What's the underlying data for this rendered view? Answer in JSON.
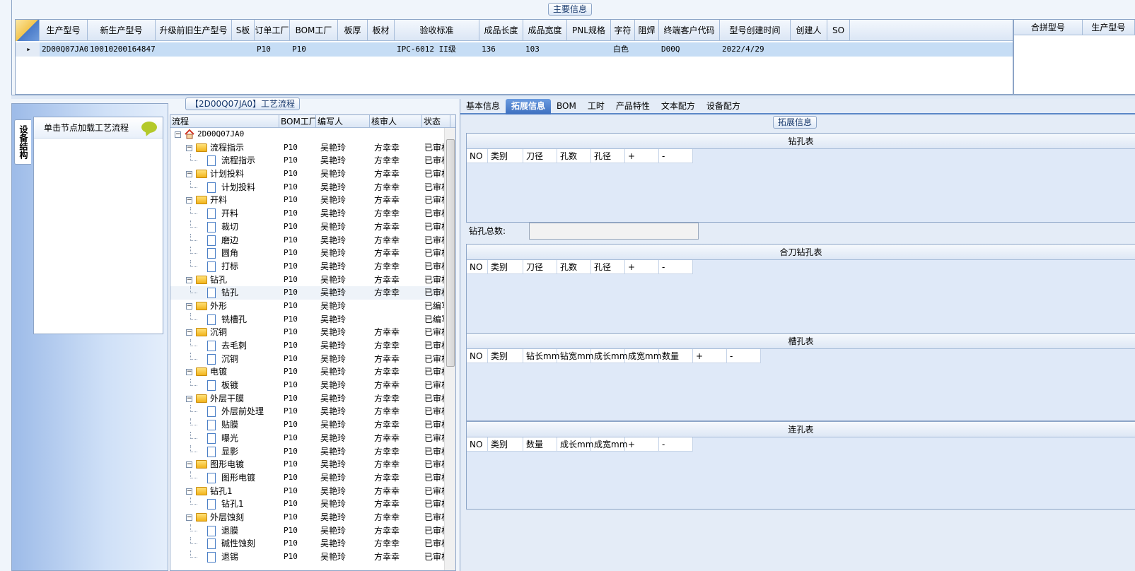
{
  "main_info": {
    "caption": "主要信息",
    "columns": [
      "生产型号",
      "新生产型号",
      "升级前旧生产型号",
      "S板",
      "订单工厂",
      "BOM工厂",
      "板厚",
      "板材",
      "验收标准",
      "成品长度",
      "成品宽度",
      "PNL规格",
      "字符",
      "阻焊",
      "终端客户代码",
      "型号创建时间",
      "创建人",
      "SO"
    ],
    "row": [
      "2D00Q07JA0",
      "10010200164847",
      "",
      "",
      "P10",
      "P10",
      "",
      "",
      "IPC-6012 II级",
      "136",
      "103",
      "",
      "白色",
      "",
      "D00Q",
      "2022/4/29",
      "",
      ""
    ]
  },
  "side_grid": {
    "columns": [
      "合拼型号",
      "生产型号"
    ]
  },
  "left_panel": {
    "vtab_label": "设备结构",
    "node_hint": "单击节点加载工艺流程"
  },
  "process": {
    "caption": "【2D00Q07JA0】工艺流程",
    "columns": [
      "流程",
      "BOM工厂",
      "编写人",
      "核审人",
      "状态"
    ],
    "rows": [
      {
        "level": 0,
        "type": "root",
        "name": "2D00Q07JA0",
        "bom": "",
        "writer": "",
        "checker": "",
        "status": ""
      },
      {
        "level": 1,
        "type": "folder",
        "name": "流程指示",
        "bom": "P10",
        "writer": "吴艳玲",
        "checker": "方幸幸",
        "status": "已审核"
      },
      {
        "level": 2,
        "type": "doc",
        "name": "流程指示",
        "bom": "P10",
        "writer": "吴艳玲",
        "checker": "方幸幸",
        "status": "已审核"
      },
      {
        "level": 1,
        "type": "folder",
        "name": "计划投料",
        "bom": "P10",
        "writer": "吴艳玲",
        "checker": "方幸幸",
        "status": "已审核"
      },
      {
        "level": 2,
        "type": "doc",
        "name": "计划投料",
        "bom": "P10",
        "writer": "吴艳玲",
        "checker": "方幸幸",
        "status": "已审核"
      },
      {
        "level": 1,
        "type": "folder",
        "name": "开料",
        "bom": "P10",
        "writer": "吴艳玲",
        "checker": "方幸幸",
        "status": "已审核"
      },
      {
        "level": 2,
        "type": "doc",
        "name": "开料",
        "bom": "P10",
        "writer": "吴艳玲",
        "checker": "方幸幸",
        "status": "已审核"
      },
      {
        "level": 2,
        "type": "doc",
        "name": "裁切",
        "bom": "P10",
        "writer": "吴艳玲",
        "checker": "方幸幸",
        "status": "已审核"
      },
      {
        "level": 2,
        "type": "doc",
        "name": "磨边",
        "bom": "P10",
        "writer": "吴艳玲",
        "checker": "方幸幸",
        "status": "已审核"
      },
      {
        "level": 2,
        "type": "doc",
        "name": "圆角",
        "bom": "P10",
        "writer": "吴艳玲",
        "checker": "方幸幸",
        "status": "已审核"
      },
      {
        "level": 2,
        "type": "doc",
        "name": "打标",
        "bom": "P10",
        "writer": "吴艳玲",
        "checker": "方幸幸",
        "status": "已审核"
      },
      {
        "level": 1,
        "type": "folder",
        "name": "钻孔",
        "bom": "P10",
        "writer": "吴艳玲",
        "checker": "方幸幸",
        "status": "已审核"
      },
      {
        "level": 2,
        "type": "doc",
        "name": "钻孔",
        "bom": "P10",
        "writer": "吴艳玲",
        "checker": "方幸幸",
        "status": "已审核",
        "selected": true
      },
      {
        "level": 1,
        "type": "folder",
        "name": "外形",
        "bom": "P10",
        "writer": "吴艳玲",
        "checker": "",
        "status": "已编写"
      },
      {
        "level": 2,
        "type": "doc",
        "name": "铣槽孔",
        "bom": "P10",
        "writer": "吴艳玲",
        "checker": "",
        "status": "已编写"
      },
      {
        "level": 1,
        "type": "folder",
        "name": "沉铜",
        "bom": "P10",
        "writer": "吴艳玲",
        "checker": "方幸幸",
        "status": "已审核"
      },
      {
        "level": 2,
        "type": "doc",
        "name": "去毛刺",
        "bom": "P10",
        "writer": "吴艳玲",
        "checker": "方幸幸",
        "status": "已审核"
      },
      {
        "level": 2,
        "type": "doc",
        "name": "沉铜",
        "bom": "P10",
        "writer": "吴艳玲",
        "checker": "方幸幸",
        "status": "已审核"
      },
      {
        "level": 1,
        "type": "folder",
        "name": "电镀",
        "bom": "P10",
        "writer": "吴艳玲",
        "checker": "方幸幸",
        "status": "已审核"
      },
      {
        "level": 2,
        "type": "doc",
        "name": "板镀",
        "bom": "P10",
        "writer": "吴艳玲",
        "checker": "方幸幸",
        "status": "已审核"
      },
      {
        "level": 1,
        "type": "folder",
        "name": "外层干膜",
        "bom": "P10",
        "writer": "吴艳玲",
        "checker": "方幸幸",
        "status": "已审核"
      },
      {
        "level": 2,
        "type": "doc",
        "name": "外层前处理",
        "bom": "P10",
        "writer": "吴艳玲",
        "checker": "方幸幸",
        "status": "已审核"
      },
      {
        "level": 2,
        "type": "doc",
        "name": "贴膜",
        "bom": "P10",
        "writer": "吴艳玲",
        "checker": "方幸幸",
        "status": "已审核"
      },
      {
        "level": 2,
        "type": "doc",
        "name": "曝光",
        "bom": "P10",
        "writer": "吴艳玲",
        "checker": "方幸幸",
        "status": "已审核"
      },
      {
        "level": 2,
        "type": "doc",
        "name": "显影",
        "bom": "P10",
        "writer": "吴艳玲",
        "checker": "方幸幸",
        "status": "已审核"
      },
      {
        "level": 1,
        "type": "folder",
        "name": "图形电镀",
        "bom": "P10",
        "writer": "吴艳玲",
        "checker": "方幸幸",
        "status": "已审核"
      },
      {
        "level": 2,
        "type": "doc",
        "name": "图形电镀",
        "bom": "P10",
        "writer": "吴艳玲",
        "checker": "方幸幸",
        "status": "已审核"
      },
      {
        "level": 1,
        "type": "folder",
        "name": "钻孔1",
        "bom": "P10",
        "writer": "吴艳玲",
        "checker": "方幸幸",
        "status": "已审核"
      },
      {
        "level": 2,
        "type": "doc",
        "name": "钻孔1",
        "bom": "P10",
        "writer": "吴艳玲",
        "checker": "方幸幸",
        "status": "已审核"
      },
      {
        "level": 1,
        "type": "folder",
        "name": "外层蚀刻",
        "bom": "P10",
        "writer": "吴艳玲",
        "checker": "方幸幸",
        "status": "已审核"
      },
      {
        "level": 2,
        "type": "doc",
        "name": "退膜",
        "bom": "P10",
        "writer": "吴艳玲",
        "checker": "方幸幸",
        "status": "已审核"
      },
      {
        "level": 2,
        "type": "doc",
        "name": "碱性蚀刻",
        "bom": "P10",
        "writer": "吴艳玲",
        "checker": "方幸幸",
        "status": "已审核"
      },
      {
        "level": 2,
        "type": "doc",
        "name": "退锡",
        "bom": "P10",
        "writer": "吴艳玲",
        "checker": "方幸幸",
        "status": "已审核"
      }
    ]
  },
  "right_panel": {
    "tabs": [
      "基本信息",
      "拓展信息",
      "BOM",
      "工时",
      "产品特性",
      "文本配方",
      "设备配方"
    ],
    "active_tab": 1,
    "ext_caption": "拓展信息",
    "drill_table": {
      "title": "钻孔表",
      "columns": [
        "NO",
        "类别",
        "刀径",
        "孔数",
        "孔径",
        "+",
        "-"
      ]
    },
    "drill_total_label": "钻孔总数:",
    "combined_table": {
      "title": "合刀钻孔表",
      "columns": [
        "NO",
        "类别",
        "刀径",
        "孔数",
        "孔径",
        "+",
        "-"
      ]
    },
    "slot_table": {
      "title": "槽孔表",
      "columns": [
        "NO",
        "类别",
        "钻长mm",
        "钻宽mm",
        "成长mm",
        "成宽mm",
        "数量",
        "+",
        "-"
      ]
    },
    "link_table": {
      "title": "连孔表",
      "columns": [
        "NO",
        "类别",
        "数量",
        "成长mm",
        "成宽mm",
        "+",
        "-"
      ]
    }
  },
  "colors": {
    "accent": "#3d6fbf",
    "selected_row": "#c6ddf5",
    "border": "#8da5c7"
  }
}
